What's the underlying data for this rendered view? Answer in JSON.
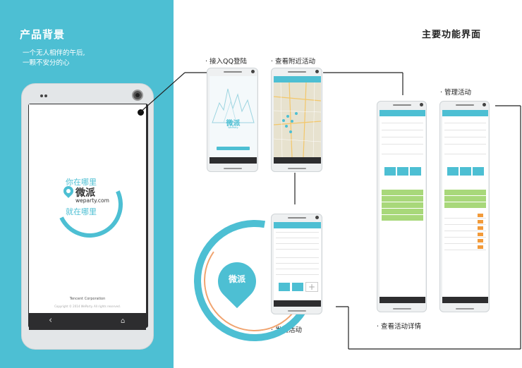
{
  "left": {
    "title": "产品背景",
    "line1": "一个无人相伴的午后,",
    "line2": "一颗不安分的心"
  },
  "splash": {
    "where_top": "你在哪里",
    "app_name": "微派",
    "url": "weparty.com",
    "where_bottom": "就在哪里",
    "company": "Tencent Corporation",
    "copyright": "Copyright © 2014 WeParty. All rights reserved."
  },
  "main_title": "主要功能界面",
  "labels": {
    "qq_login": "· 接入QQ登陆",
    "nearby": "· 查看附近活动",
    "manage": "· 管理活动",
    "launch": "· 发起活动",
    "detail": "· 查看活动详情"
  },
  "login_screen": {
    "app_name": "微派",
    "sub": "WeParty"
  },
  "big_pin_text": "微派",
  "colors": {
    "accent": "#4dbfd3",
    "panel": "#4dbfd3",
    "orange": "#f29a3a",
    "green": "#a8d87a"
  },
  "nav_icons": [
    "back-icon",
    "home-icon"
  ]
}
